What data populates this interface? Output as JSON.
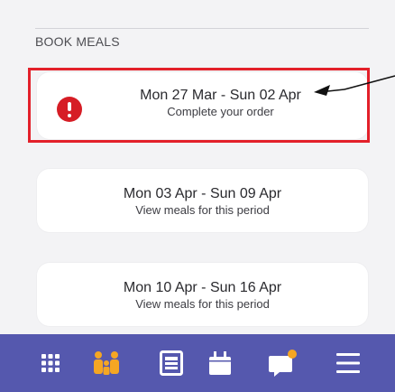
{
  "section": {
    "title": "BOOK MEALS"
  },
  "periods": [
    {
      "dates": "Mon 27 Mar - Sun 02 Apr",
      "action": "Complete your order",
      "status": "alert"
    },
    {
      "dates": "Mon 03 Apr - Sun 09 Apr",
      "action": "View meals for this period"
    },
    {
      "dates": "Mon 10 Apr - Sun 16 Apr",
      "action": "View meals for this period"
    }
  ],
  "colors": {
    "nav_background": "#5558ae",
    "active_icon": "#f5a623",
    "alert": "#d61d25",
    "highlight_outline": "#e3202a"
  },
  "bottom_nav": {
    "items": [
      {
        "icon": "grid-icon",
        "active": false
      },
      {
        "icon": "family-icon",
        "active": true
      },
      {
        "icon": "menu-card-icon",
        "active": false
      },
      {
        "icon": "calendar-icon",
        "active": false
      },
      {
        "icon": "chat-icon",
        "active": false,
        "badge": true
      },
      {
        "icon": "hamburger-icon",
        "active": false
      }
    ]
  }
}
